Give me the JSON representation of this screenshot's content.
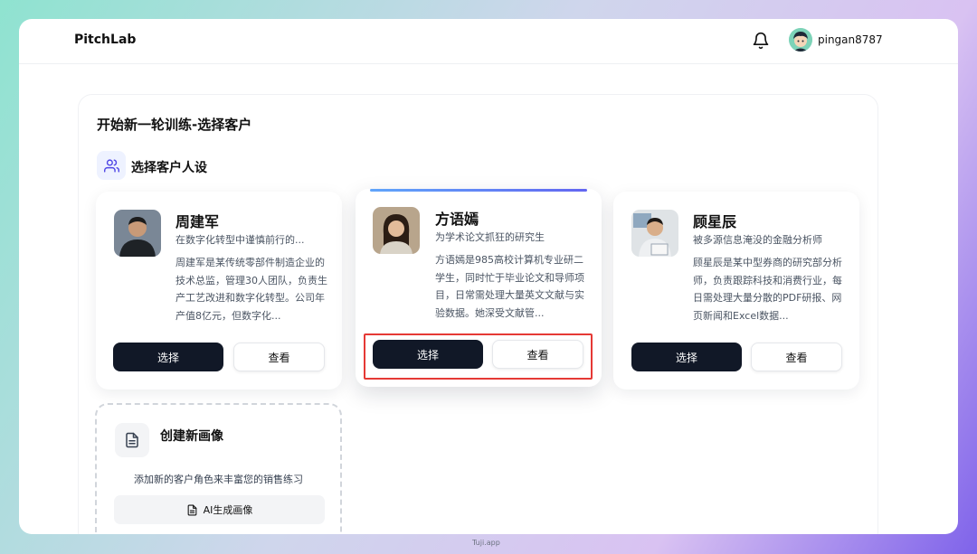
{
  "header": {
    "logo": "PitchLab",
    "username": "pingan8787"
  },
  "page": {
    "title": "开始新一轮训练-选择客户",
    "section_title": "选择客户人设"
  },
  "personas": [
    {
      "name": "周建军",
      "tagline": "在数字化转型中谨慎前行的...",
      "description": "周建军是某传统零部件制造企业的技术总监，管理30人团队，负责生产工艺改进和数字化转型。公司年产值8亿元，但数字化...",
      "select_label": "选择",
      "view_label": "查看"
    },
    {
      "name": "方语嫣",
      "tagline": "为学术论文抓狂的研究生",
      "description": "方语嫣是985高校计算机专业研二学生，同时忙于毕业论文和导师项目，日常需处理大量英文文献与实验数据。她深受文献管...",
      "select_label": "选择",
      "view_label": "查看"
    },
    {
      "name": "顾星辰",
      "tagline": "被多源信息淹没的金融分析师",
      "description": "顾星辰是某中型券商的研究部分析师，负责跟踪科技和消费行业，每日需处理大量分散的PDF研报、网页新闻和Excel数据...",
      "select_label": "选择",
      "view_label": "查看"
    }
  ],
  "create": {
    "title": "创建新画像",
    "description": "添加新的客户角色来丰富您的销售练习",
    "ai_button": "AI生成画像"
  },
  "watermark": "Tuji.app",
  "colors": {
    "primary": "#111827",
    "accent": "#6366f1",
    "highlight": "#e53935"
  },
  "icons": {
    "notification": "bell-icon",
    "section": "users-icon",
    "create": "document-icon"
  }
}
